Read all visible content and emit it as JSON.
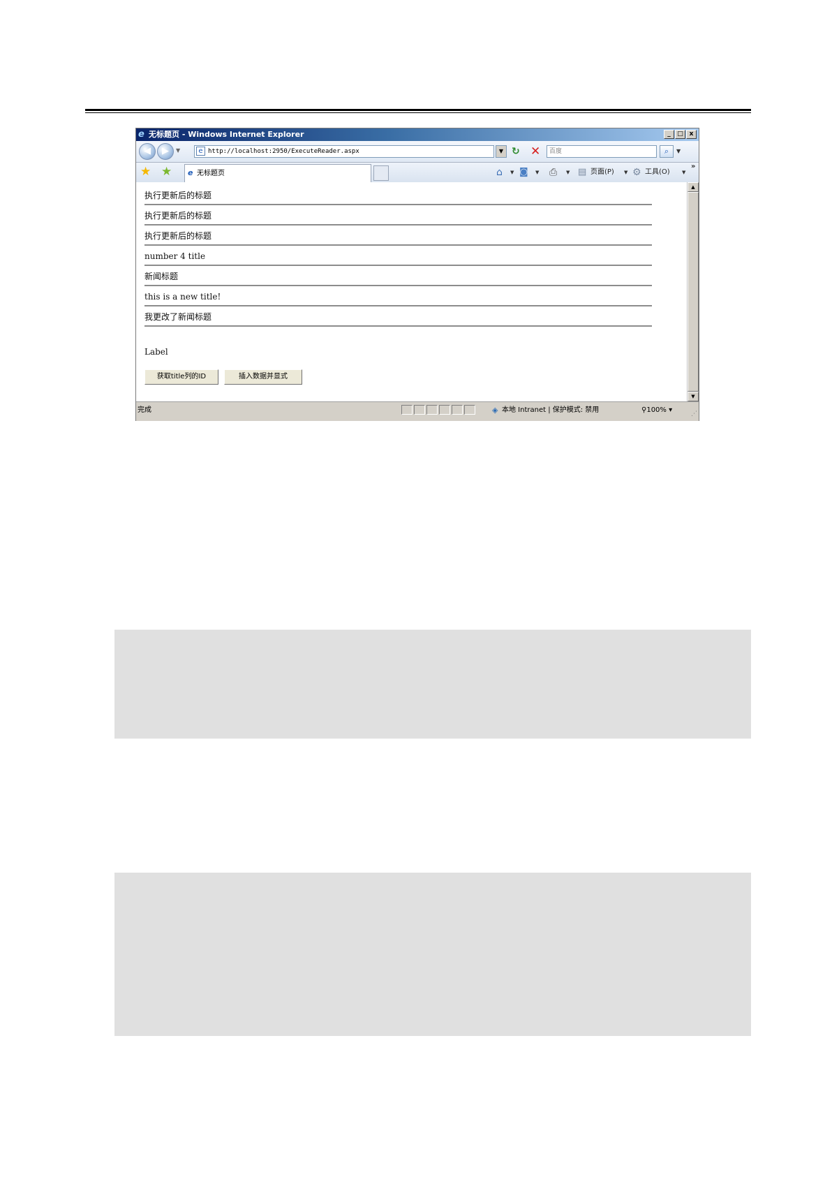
{
  "window": {
    "title": "无标题页 - Windows Internet Explorer",
    "controls": {
      "minimize": "_",
      "maximize": "□",
      "close": "x"
    }
  },
  "navbar": {
    "address": "http://localhost:2950/ExecuteReader.aspx",
    "search_placeholder": "百度"
  },
  "favbar": {
    "tab_title": "无标题页",
    "page_menu": "页面(P)",
    "tools_menu": "工具(O)",
    "more": "»"
  },
  "content": {
    "items": [
      "执行更新后的标题",
      "执行更新后的标题",
      "执行更新后的标题",
      "number 4 title",
      "新闻标题",
      "this is a new title!",
      "我更改了新闻标题"
    ],
    "label": "Label",
    "buttons": {
      "get_id": "获取title列的ID",
      "insert": "插入数据并显式"
    }
  },
  "statusbar": {
    "status": "完成",
    "zone": "本地 Intranet | 保护模式: 禁用",
    "zoom": "100%"
  },
  "colors": {
    "titlebar_start": "#0a246a",
    "titlebar_end": "#a6caf0",
    "code_block_bg": "#e0e0e0"
  },
  "icons": [
    "ie-logo-icon",
    "back-icon",
    "forward-icon",
    "page-icon",
    "refresh-icon",
    "stop-icon",
    "search-icon",
    "favorites-star-icon",
    "add-favorites-icon",
    "home-icon",
    "feeds-icon",
    "print-icon",
    "page-menu-icon",
    "tools-gear-icon",
    "intranet-zone-icon",
    "zoom-icon"
  ]
}
